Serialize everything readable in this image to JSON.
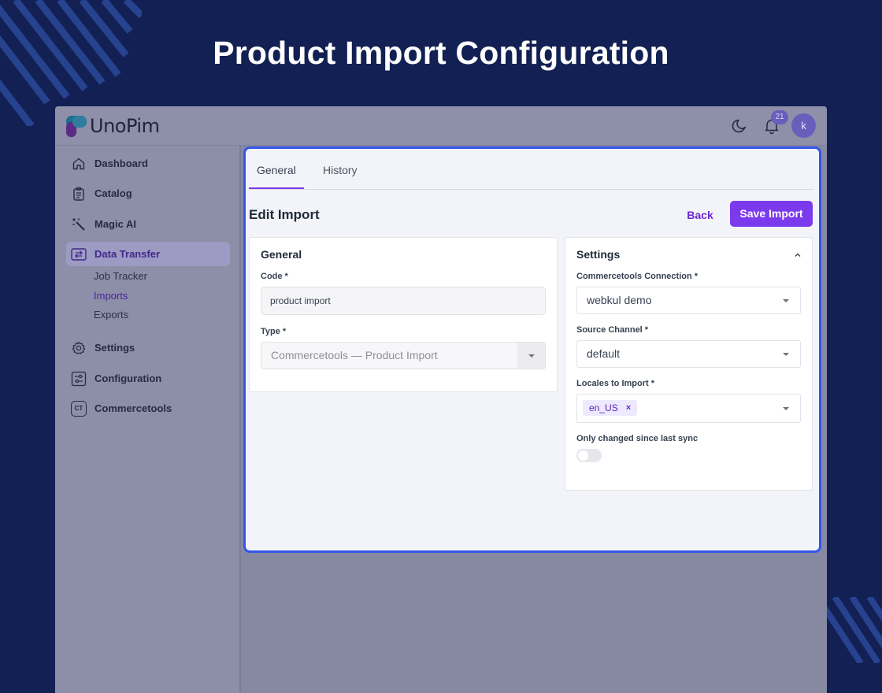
{
  "page_title": "Product Import Configuration",
  "app": {
    "logo_text": "UnoPim",
    "notification_count": "21",
    "avatar_initial": "k"
  },
  "sidebar": {
    "items": [
      {
        "label": "Dashboard",
        "icon": "home-icon"
      },
      {
        "label": "Catalog",
        "icon": "clipboard-icon"
      },
      {
        "label": "Magic AI",
        "icon": "magic-wand-icon"
      },
      {
        "label": "Data Transfer",
        "icon": "transfer-icon"
      },
      {
        "label": "Settings",
        "icon": "gear-icon"
      },
      {
        "label": "Configuration",
        "icon": "sliders-icon"
      },
      {
        "label": "Commercetools",
        "icon": "ct-icon"
      }
    ],
    "ct_badge": "CT",
    "sub_items": [
      {
        "label": "Job Tracker"
      },
      {
        "label": "Imports"
      },
      {
        "label": "Exports"
      }
    ]
  },
  "tabs": [
    {
      "label": "General"
    },
    {
      "label": "History"
    }
  ],
  "edit": {
    "title": "Edit Import",
    "back_label": "Back",
    "save_label": "Save Import"
  },
  "general_card": {
    "title": "General",
    "code_label": "Code *",
    "code_value": "product import",
    "type_label": "Type *",
    "type_value": "Commercetools — Product Import"
  },
  "settings_card": {
    "title": "Settings",
    "connection_label": "Commercetools Connection *",
    "connection_value": "webkul demo",
    "channel_label": "Source Channel *",
    "channel_value": "default",
    "locales_label": "Locales to Import *",
    "locale_chip": "en_US",
    "chip_remove": "×",
    "sync_label": "Only changed since last sync",
    "sync_enabled": false
  },
  "colors": {
    "background": "#122053",
    "accent": "#7c3aed",
    "highlight_border": "#3356e8"
  }
}
